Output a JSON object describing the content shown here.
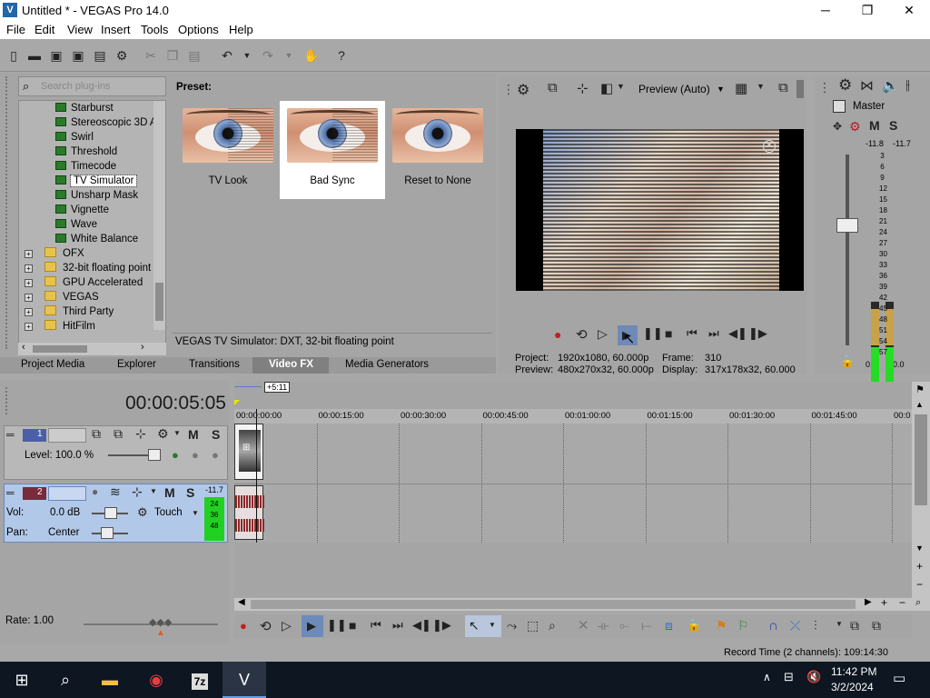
{
  "window": {
    "title": "Untitled * - VEGAS Pro 14.0",
    "min": "─",
    "max": "❐",
    "close": "✕"
  },
  "menu": [
    "File",
    "Edit",
    "View",
    "Insert",
    "Tools",
    "Options",
    "Help"
  ],
  "plugins": {
    "search_placeholder": "Search plug-ins",
    "preset_label": "Preset:",
    "tree_items": [
      "Starburst",
      "Stereoscopic 3D A",
      "Swirl",
      "Threshold",
      "Timecode",
      "TV Simulator",
      "Unsharp Mask",
      "Vignette",
      "Wave",
      "White Balance"
    ],
    "tree_folders": [
      "OFX",
      "32-bit floating point",
      "GPU Accelerated",
      "VEGAS",
      "Third Party",
      "HitFilm"
    ],
    "presets": [
      "TV Look",
      "Bad Sync",
      "Reset to None"
    ],
    "status": "VEGAS TV Simulator: DXT, 32-bit floating point"
  },
  "tabs": [
    "Project Media",
    "Explorer",
    "Transitions",
    "Video FX",
    "Media Generators"
  ],
  "active_tab": "Video FX",
  "preview": {
    "quality": "Preview (Auto)",
    "project_label": "Project:",
    "project_value": "1920x1080, 60.000p",
    "preview_label": "Preview:",
    "preview_value": "480x270x32, 60.000p",
    "frame_label": "Frame:",
    "frame_value": "310",
    "display_label": "Display:",
    "display_value": "317x178x32, 60.000"
  },
  "master": {
    "label": "Master",
    "left_peak": "-11.8",
    "right_peak": "-11.7",
    "left_val": "0.0",
    "right_val": "0.0",
    "scale": [
      "3",
      "6",
      "9",
      "12",
      "15",
      "18",
      "21",
      "24",
      "27",
      "30",
      "33",
      "36",
      "39",
      "42",
      "45",
      "48",
      "51",
      "54",
      "57"
    ]
  },
  "timeline": {
    "timecode": "00:00:05:05",
    "marker": "+5:11",
    "ruler": [
      "00:00:00:00",
      "00:00:15:00",
      "00:00:30:00",
      "00:00:45:00",
      "00:01:00:00",
      "00:01:15:00",
      "00:01:30:00",
      "00:01:45:00",
      "00:0"
    ],
    "track1": {
      "num": "1",
      "level": "Level: 100.0 %",
      "m": "M",
      "s": "S"
    },
    "track2": {
      "num": "2",
      "vol_label": "Vol:",
      "vol_value": "0.0 dB",
      "pan_label": "Pan:",
      "pan_value": "Center",
      "mode": "Touch",
      "m": "M",
      "s": "S",
      "peak": "-11.7",
      "meter": [
        "24",
        "36",
        "48"
      ]
    }
  },
  "rate": "Rate: 1.00",
  "status": "Record Time (2 channels): 109:14:30",
  "taskbar": {
    "time": "11:42 PM",
    "date": "3/2/2024",
    "zip": "7z"
  }
}
